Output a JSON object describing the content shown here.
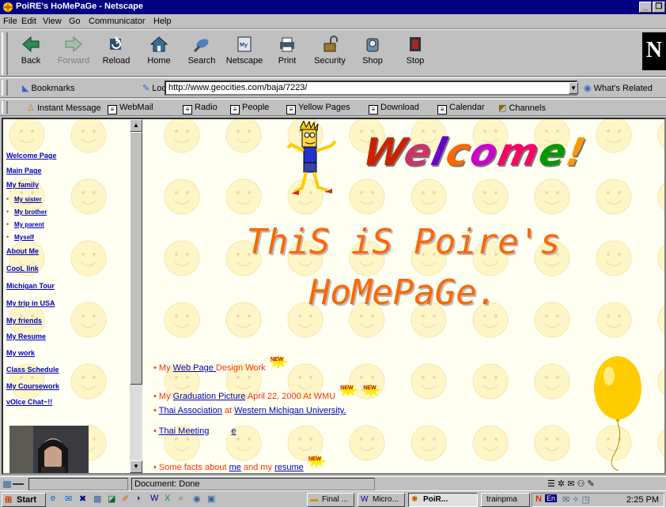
{
  "window": {
    "title": "PoiRE's HoMePaGe - Netscape",
    "minimize_icon": "minimize-icon",
    "restore_icon": "restore-icon"
  },
  "menu": [
    "File",
    "Edit",
    "View",
    "Go",
    "Communicator",
    "Help"
  ],
  "toolbar": {
    "buttons": [
      {
        "label": "Back",
        "icon": "back-arrow-icon"
      },
      {
        "label": "Forward",
        "icon": "forward-arrow-icon",
        "disabled": true
      },
      {
        "label": "Reload",
        "icon": "reload-icon"
      },
      {
        "label": "Home",
        "icon": "home-icon"
      },
      {
        "label": "Search",
        "icon": "search-icon"
      },
      {
        "label": "Netscape",
        "icon": "my-netscape-icon"
      },
      {
        "label": "Print",
        "icon": "printer-icon"
      },
      {
        "label": "Security",
        "icon": "lock-icon"
      },
      {
        "label": "Shop",
        "icon": "shop-icon"
      },
      {
        "label": "Stop",
        "icon": "stop-icon"
      }
    ],
    "logo": "N"
  },
  "location_bar": {
    "bookmarks_label": "Bookmarks",
    "location_label": "Location:",
    "url": "http://www.geocities.com/baja/7223/",
    "whats_related_label": "What's Related"
  },
  "personal_toolbar": [
    "Instant Message",
    "WebMail",
    "Radio",
    "People",
    "Yellow Pages",
    "Download",
    "Calendar",
    "Channels"
  ],
  "left_nav": {
    "links": [
      {
        "label": "Welcome Page",
        "sub": false
      },
      {
        "label": "Main Page",
        "sub": false
      },
      {
        "label": "My family",
        "sub": false
      },
      {
        "label": "My sister",
        "sub": true
      },
      {
        "label": "My brother",
        "sub": true
      },
      {
        "label": "My parent",
        "sub": true
      },
      {
        "label": "Myself",
        "sub": true
      },
      {
        "label": "About Me",
        "sub": false
      },
      {
        "label": "CooL link",
        "sub": false
      },
      {
        "label": "Michigan Tour",
        "sub": false
      },
      {
        "label": "My trip in USA",
        "sub": false
      },
      {
        "label": "My friends",
        "sub": false
      },
      {
        "label": "My Resume",
        "sub": false
      },
      {
        "label": "My work",
        "sub": false
      },
      {
        "label": "Class Schedule",
        "sub": false
      },
      {
        "label": "My Coursework",
        "sub": false
      },
      {
        "label": "vOIce Chat~!!",
        "sub": false
      }
    ]
  },
  "main": {
    "welcome_letters": [
      "W",
      "e",
      "l",
      "c",
      "o",
      "m",
      "e",
      "!"
    ],
    "welcome_colors": [
      "#cc2200",
      "#cc3366",
      "#6600cc",
      "#ff6600",
      "#cc00cc",
      "#ff0066",
      "#009900",
      "#ff9900"
    ],
    "heading_line1": "ThiS iS Poire's",
    "heading_line2": "HoMePaGe.",
    "new_badge": "NEW",
    "items": [
      {
        "pre": "My ",
        "link": "Web Page ",
        "post": "Design Work",
        "new_count": 1
      },
      {
        "pre": "My ",
        "link": "Graduation Picture",
        "post": " April 22, 2000 At WMU",
        "new_count": 2
      },
      {
        "pre": "",
        "link": "Thai Association",
        "post": " at ",
        "link2": "Western Michigan University.",
        "new_count": 0
      },
      {
        "pre": "",
        "link": "Thai Meeting",
        "post": "",
        "link2": "e",
        "new_count": 0
      },
      {
        "pre": "Some facts about ",
        "link": "me",
        "post": " and my ",
        "link2": "resume",
        "new_count": 1
      }
    ]
  },
  "status": {
    "text": "Document: Done"
  },
  "taskbar": {
    "start_label": "Start",
    "tasks": [
      "Final ...",
      "Micro...",
      "PoiR...",
      "trainpma"
    ],
    "active_task": 2,
    "clock": "2:25 PM",
    "lang": "En"
  },
  "colors": {
    "title_bar": "#000080",
    "link": "#0000c0",
    "accent_orange": "#ff6600",
    "balloon": "#ffcc00"
  }
}
